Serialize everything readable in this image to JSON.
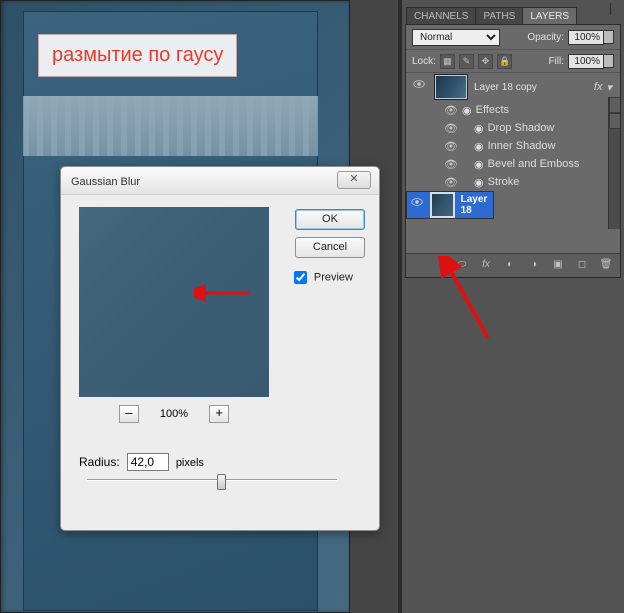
{
  "annotation_label": "размытие по гаусу",
  "dialog": {
    "title": "Gaussian Blur",
    "ok_label": "OK",
    "cancel_label": "Cancel",
    "preview_label": "Preview",
    "zoom_level": "100%",
    "radius_label": "Radius:",
    "radius_value": "42,0",
    "radius_unit": "pixels",
    "close_glyph": "✕"
  },
  "panels": {
    "tabs": {
      "channels": "CHANNELS",
      "paths": "PATHS",
      "layers": "LAYERS"
    },
    "blend_mode": "Normal",
    "opacity_label": "Opacity:",
    "opacity_value": "100%",
    "lock_label": "Lock:",
    "fill_label": "Fill:",
    "fill_value": "100%",
    "layers": [
      {
        "name": "Layer 18 copy",
        "fx_label": "fx",
        "effects_label": "Effects",
        "effects": [
          "Drop Shadow",
          "Inner Shadow",
          "Bevel and Emboss",
          "Stroke"
        ]
      },
      {
        "name": "Layer 18"
      }
    ],
    "footer_icons": [
      "link-icon",
      "fx-icon",
      "mask-icon",
      "adjust-icon",
      "group-icon",
      "new-icon",
      "trash-icon"
    ]
  }
}
